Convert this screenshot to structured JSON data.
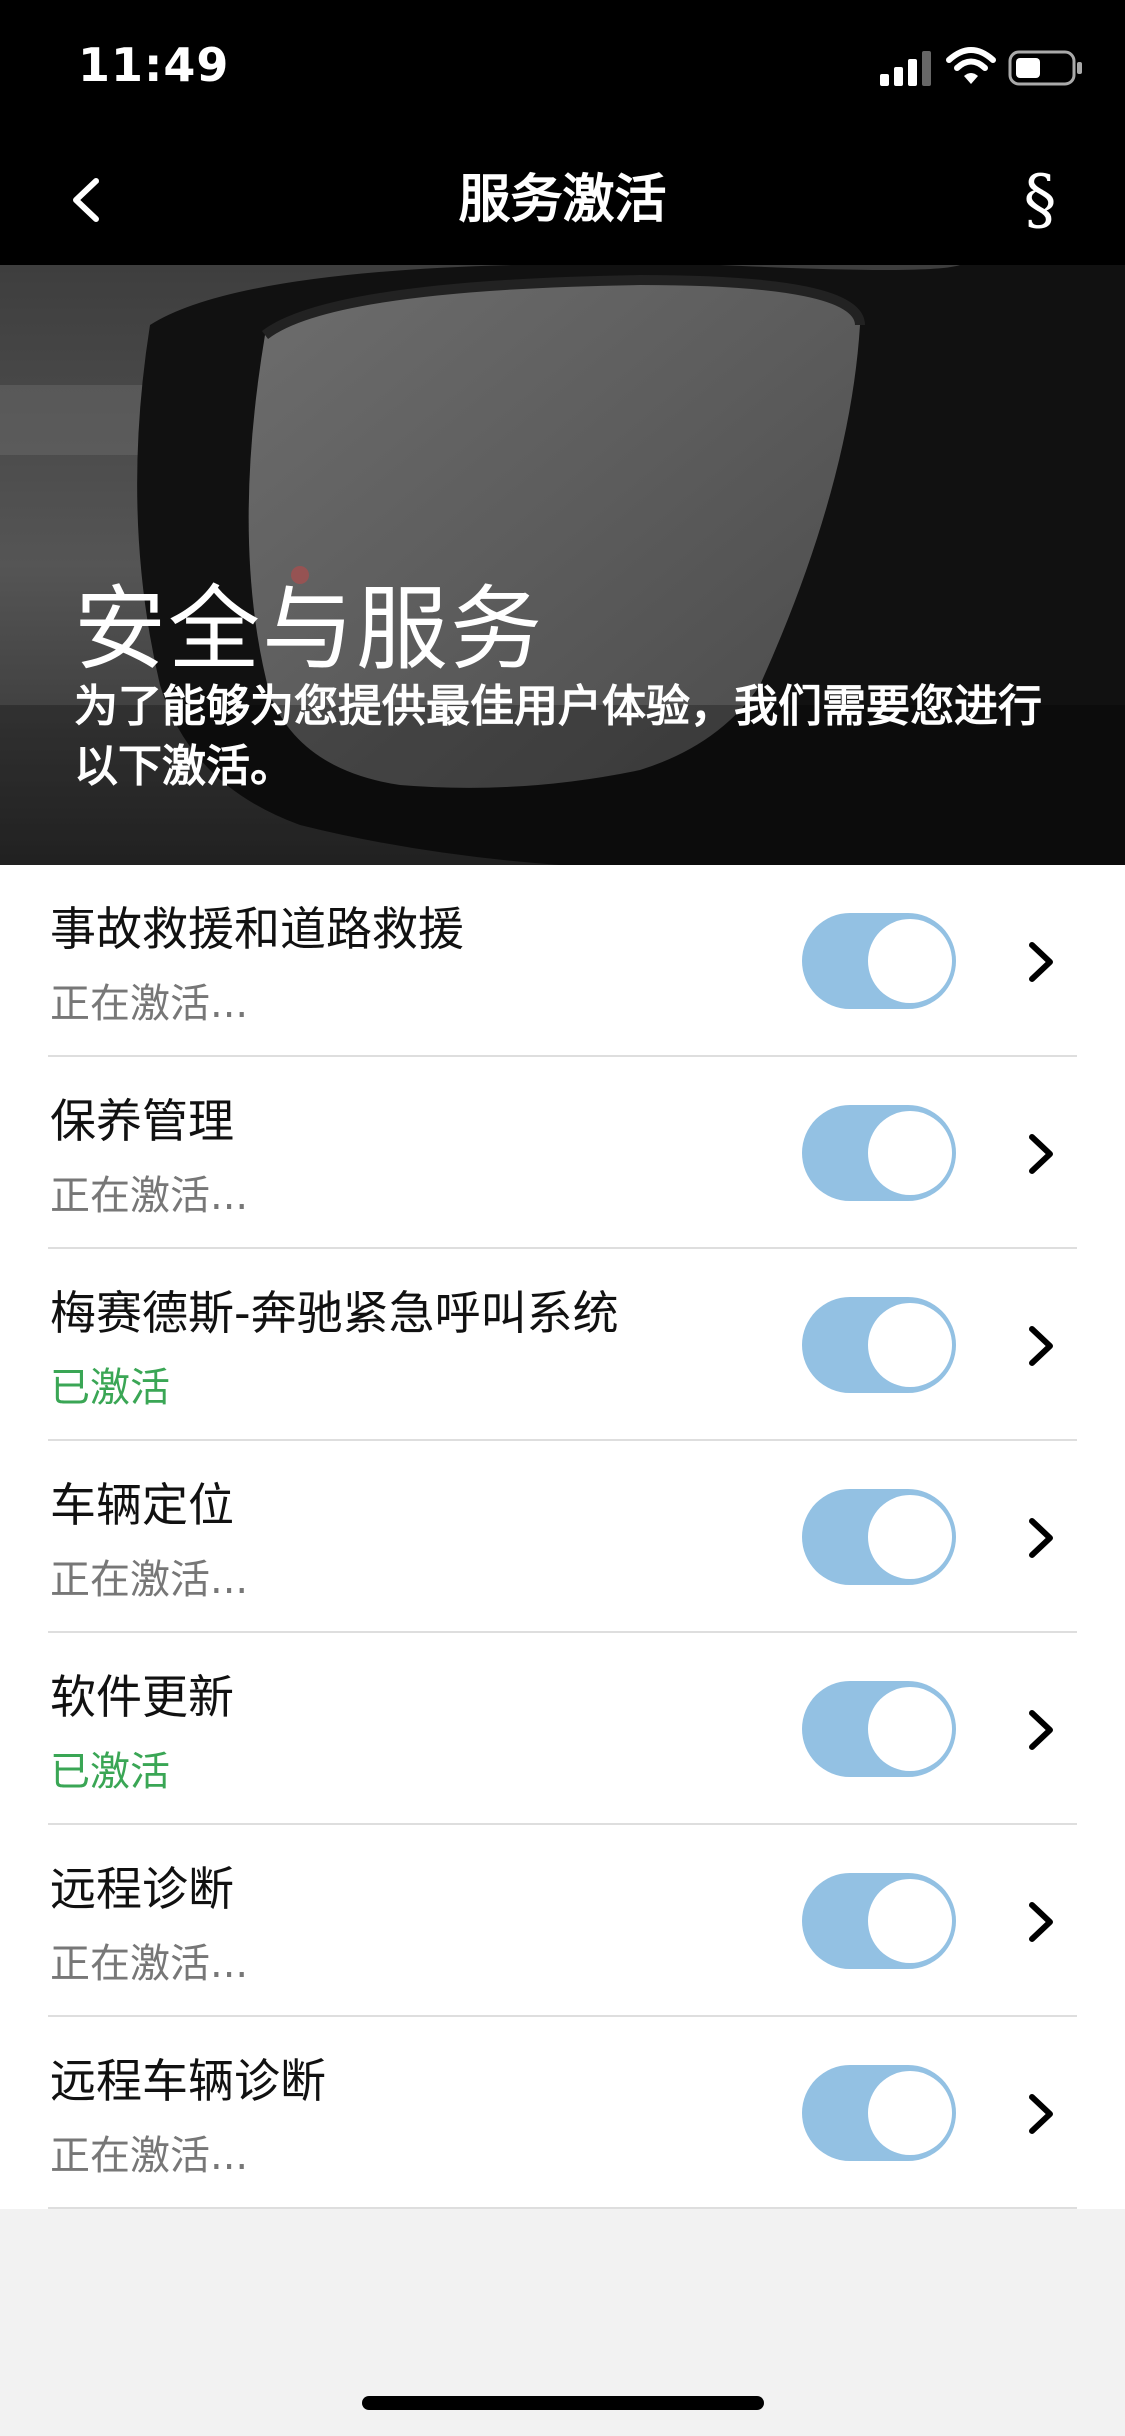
{
  "status_bar": {
    "time": "11:49",
    "icons": [
      "signal-icon",
      "wifi-icon",
      "battery-icon"
    ]
  },
  "nav": {
    "title": "服务激活",
    "back_icon": "chevron-left-icon",
    "legal_icon": "§"
  },
  "hero": {
    "title": "安全与服务",
    "subtitle": "为了能够为您提供最佳用户体验，我们需要您进行以下激活。"
  },
  "colors": {
    "toggle_on": "#93c1e3",
    "status_active": "#3aa655",
    "status_pending": "#777777",
    "header_bg": "#000000",
    "page_bg": "#f2f2f2"
  },
  "services": [
    {
      "name": "事故救援和道路救援",
      "status": "正在激活...",
      "state": "pending",
      "toggle_on": true
    },
    {
      "name": "保养管理",
      "status": "正在激活...",
      "state": "pending",
      "toggle_on": true
    },
    {
      "name": "梅赛德斯-奔驰紧急呼叫系统",
      "status": "已激活",
      "state": "active",
      "toggle_on": true
    },
    {
      "name": "车辆定位",
      "status": "正在激活...",
      "state": "pending",
      "toggle_on": true
    },
    {
      "name": "软件更新",
      "status": "已激活",
      "state": "active",
      "toggle_on": true
    },
    {
      "name": "远程诊断",
      "status": "正在激活...",
      "state": "pending",
      "toggle_on": true
    },
    {
      "name": "远程车辆诊断",
      "status": "正在激活...",
      "state": "pending",
      "toggle_on": true
    }
  ]
}
